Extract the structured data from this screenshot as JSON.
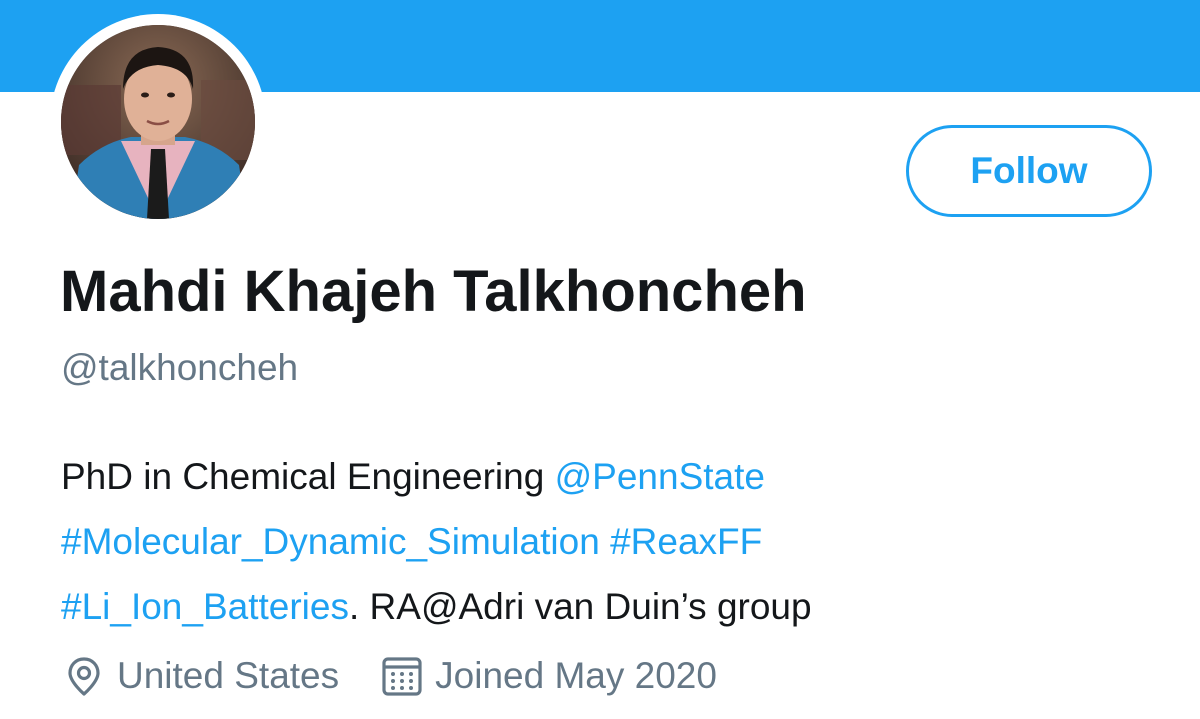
{
  "banner": {
    "color": "#1da1f2"
  },
  "profile": {
    "avatar_icon": "profile-photo",
    "display_name": "Mahdi Khajeh Talkhoncheh",
    "handle": "@talkhoncheh",
    "follow_label": "Follow"
  },
  "bio": {
    "line1_text": "PhD in Chemical Engineering ",
    "line1_mention": "@PennState",
    "line2_hashtag1": "#Molecular_Dynamic_Simulation",
    "line2_space": " ",
    "line2_hashtag2": "#ReaxFF",
    "line3_hashtag": "#Li_Ion_Batteries",
    "line3_text": ". RA@Adri van Duin’s group"
  },
  "meta": {
    "location": "United States",
    "location_icon": "location-pin-icon",
    "joined": "Joined May 2020",
    "joined_icon": "calendar-icon"
  },
  "colors": {
    "accent": "#1da1f2",
    "text": "#14171a",
    "secondary": "#657786"
  }
}
